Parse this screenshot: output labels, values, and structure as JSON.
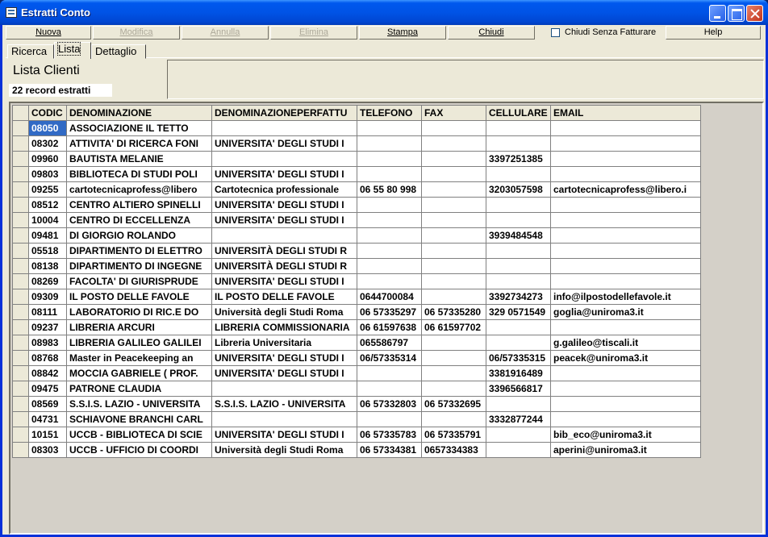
{
  "window": {
    "title": "Estratti Conto"
  },
  "toolbar": {
    "nuova": "Nuova",
    "modifica": "Modifica",
    "annulla": "Annulla",
    "elimina": "Elimina",
    "stampa": "Stampa",
    "chiudi": "Chiudi",
    "chiudi_senza_fatturare": "Chiudi Senza Fatturare",
    "help": "Help"
  },
  "tabs": {
    "ricerca": "Ricerca",
    "lista": "Lista",
    "dettaglio": "Dettaglio"
  },
  "panel": {
    "title": "Lista Clienti",
    "record_count": "22 record estratti"
  },
  "table": {
    "columns": [
      "CODIC",
      "DENOMINAZIONE",
      "DENOMINAZIONEPERFATTU",
      "TELEFONO",
      "FAX",
      "CELLULARE",
      "EMAIL"
    ],
    "rows": [
      [
        "08050",
        "ASSOCIAZIONE IL TETTO",
        "",
        "",
        "",
        "",
        ""
      ],
      [
        "08302",
        "ATTIVITA' DI RICERCA FONI",
        "UNIVERSITA' DEGLI STUDI I",
        "",
        "",
        "",
        ""
      ],
      [
        "09960",
        "BAUTISTA MELANIE",
        "",
        "",
        "",
        "3397251385",
        ""
      ],
      [
        "09803",
        "BIBLIOTECA DI STUDI POLI",
        "UNIVERSITA' DEGLI STUDI I",
        "",
        "",
        "",
        ""
      ],
      [
        "09255",
        "cartotecnicaprofess@libero",
        "Cartotecnica professionale",
        "06 55 80 998",
        "",
        "3203057598",
        "cartotecnicaprofess@libero.i"
      ],
      [
        "08512",
        "CENTRO ALTIERO SPINELLI",
        "UNIVERSITA' DEGLI STUDI I",
        "",
        "",
        "",
        ""
      ],
      [
        "10004",
        "CENTRO DI ECCELLENZA",
        "UNIVERSITA' DEGLI STUDI I",
        "",
        "",
        "",
        ""
      ],
      [
        "09481",
        "DI GIORGIO ROLANDO",
        "",
        "",
        "",
        "3939484548",
        ""
      ],
      [
        "05518",
        "DIPARTIMENTO DI ELETTRO",
        "UNIVERSITÀ DEGLI STUDI R",
        "",
        "",
        "",
        ""
      ],
      [
        "08138",
        "DIPARTIMENTO DI INGEGNE",
        "UNIVERSITÀ DEGLI STUDI R",
        "",
        "",
        "",
        ""
      ],
      [
        "08269",
        "FACOLTA' DI GIURISPRUDE",
        "UNIVERSITA' DEGLI STUDI I",
        "",
        "",
        "",
        ""
      ],
      [
        "09309",
        "IL POSTO DELLE FAVOLE",
        "IL POSTO DELLE FAVOLE",
        "0644700084",
        "",
        "3392734273",
        "info@ilpostodellefavole.it"
      ],
      [
        "08111",
        "LABORATORIO DI RIC.E DO",
        "Università degli Studi Roma",
        "06 57335297",
        "06 57335280",
        "329 0571549",
        "goglia@uniroma3.it"
      ],
      [
        "09237",
        "LIBRERIA ARCURI",
        "LIBRERIA COMMISSIONARIA",
        "06 61597638",
        "06 61597702",
        "",
        ""
      ],
      [
        "08983",
        "LIBRERIA GALILEO GALILEI",
        "Libreria Universitaria",
        "065586797",
        "",
        "",
        "g.galileo@tiscali.it"
      ],
      [
        "08768",
        "Master in Peacekeeping an",
        "UNIVERSITA' DEGLI STUDI I",
        "06/57335314",
        "",
        "06/57335315",
        "peacek@uniroma3.it"
      ],
      [
        "08842",
        "MOCCIA GABRIELE ( PROF.",
        "UNIVERSITA' DEGLI STUDI I",
        "",
        "",
        "3381916489",
        ""
      ],
      [
        "09475",
        "PATRONE CLAUDIA",
        "",
        "",
        "",
        "3396566817",
        ""
      ],
      [
        "08569",
        "S.S.I.S. LAZIO - UNIVERSITA",
        "S.S.I.S. LAZIO - UNIVERSITA",
        "06 57332803",
        "06 57332695",
        "",
        ""
      ],
      [
        "04731",
        "SCHIAVONE BRANCHI CARL",
        "",
        "",
        "",
        "3332877244",
        ""
      ],
      [
        "10151",
        "UCCB - BIBLIOTECA DI SCIE",
        "UNIVERSITA' DEGLI STUDI I",
        "06 57335783",
        "06 57335791",
        "",
        "bib_eco@uniroma3.it"
      ],
      [
        "08303",
        "UCCB - UFFICIO DI COORDI",
        "Università degli Studi Roma",
        "06 57334381",
        "0657334383",
        "",
        "aperini@uniroma3.it"
      ]
    ]
  }
}
